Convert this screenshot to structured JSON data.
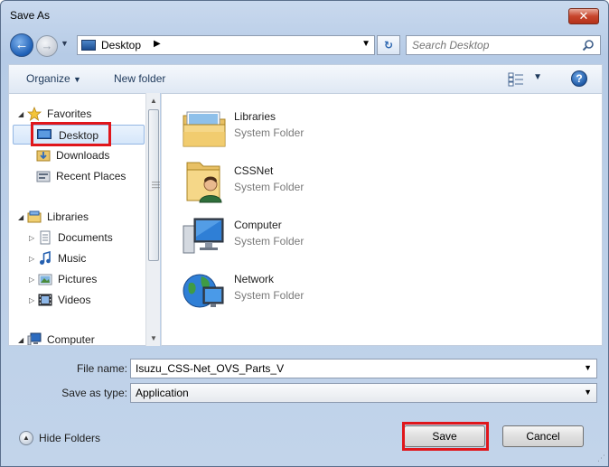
{
  "window": {
    "title": "Save As"
  },
  "nav": {
    "address_location": "Desktop",
    "search_placeholder": "Search Desktop"
  },
  "toolbar": {
    "organize_label": "Organize",
    "new_folder_label": "New folder"
  },
  "navpane": {
    "favorites": {
      "label": "Favorites",
      "items": [
        {
          "label": "Desktop",
          "selected": true
        },
        {
          "label": "Downloads"
        },
        {
          "label": "Recent Places"
        }
      ]
    },
    "libraries": {
      "label": "Libraries",
      "items": [
        {
          "label": "Documents"
        },
        {
          "label": "Music"
        },
        {
          "label": "Pictures"
        },
        {
          "label": "Videos"
        }
      ]
    },
    "computer": {
      "label": "Computer"
    }
  },
  "content": {
    "items": [
      {
        "name": "Libraries",
        "type": "System Folder",
        "icon": "libraries-folder-icon"
      },
      {
        "name": "CSSNet",
        "type": "System Folder",
        "icon": "user-folder-icon"
      },
      {
        "name": "Computer",
        "type": "System Folder",
        "icon": "computer-icon"
      },
      {
        "name": "Network",
        "type": "System Folder",
        "icon": "network-globe-icon"
      }
    ]
  },
  "form": {
    "file_name_label": "File name:",
    "file_name_value": "Isuzu_CSS-Net_OVS_Parts_V",
    "save_type_label": "Save as type:",
    "save_type_value": "Application"
  },
  "footer": {
    "hide_folders_label": "Hide Folders",
    "save_label": "Save",
    "cancel_label": "Cancel"
  },
  "colors": {
    "highlight_box": "#e0161b",
    "selection_bg": "#d5e6fa"
  }
}
